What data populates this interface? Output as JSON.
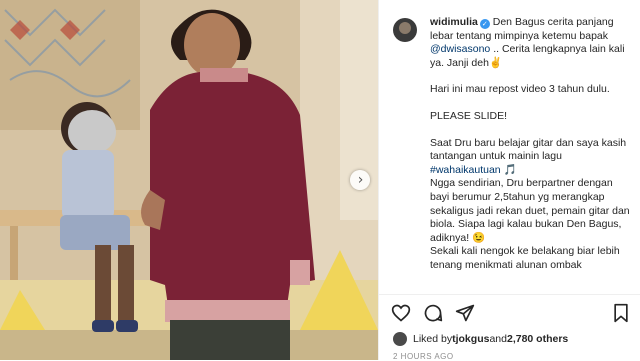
{
  "post": {
    "username": "widimulia",
    "caption_head": " Den Bagus cerita panjang lebar tentang mimpinya ketemu bapak ",
    "mention": "@dwisasono",
    "caption_head_tail": " .. Cerita lengkapnya lain kali ya. Janji deh✌",
    "caption_p2": "Hari ini mau repost video 3 tahun dulu.",
    "caption_p3": "PLEASE SLIDE!",
    "caption_p4a": "Saat Dru baru belajar gitar dan saya kasih tantangan untuk mainin lagu ",
    "hashtag": "#wahaikautuan",
    "caption_p4b": " 🎵",
    "caption_p4c": "Ngga sendirian, Dru berpartner dengan bayi berumur 2,5tahun yg merangkap sekaligus jadi rekan duet, pemain gitar dan biola. Siapa lagi kalau bukan Den Bagus, adiknya! 😉",
    "caption_p4d": "Sekali kali nengok ke belakang biar lebih tenang menikmati alunan ombak"
  },
  "likes": {
    "prefix": "Liked by ",
    "user": "tjokgus",
    "mid": " and ",
    "count": "2,780 others"
  },
  "timeago": "2 HOURS AGO",
  "icons": {
    "verified": "verified-badge-icon",
    "like": "heart-icon",
    "comment": "comment-icon",
    "share": "send-icon",
    "save": "bookmark-icon",
    "next": "chevron-right-icon"
  },
  "colors": {
    "verified": "#3897f0",
    "link": "#00376b",
    "text": "#262626",
    "muted": "#8e8e8e"
  }
}
